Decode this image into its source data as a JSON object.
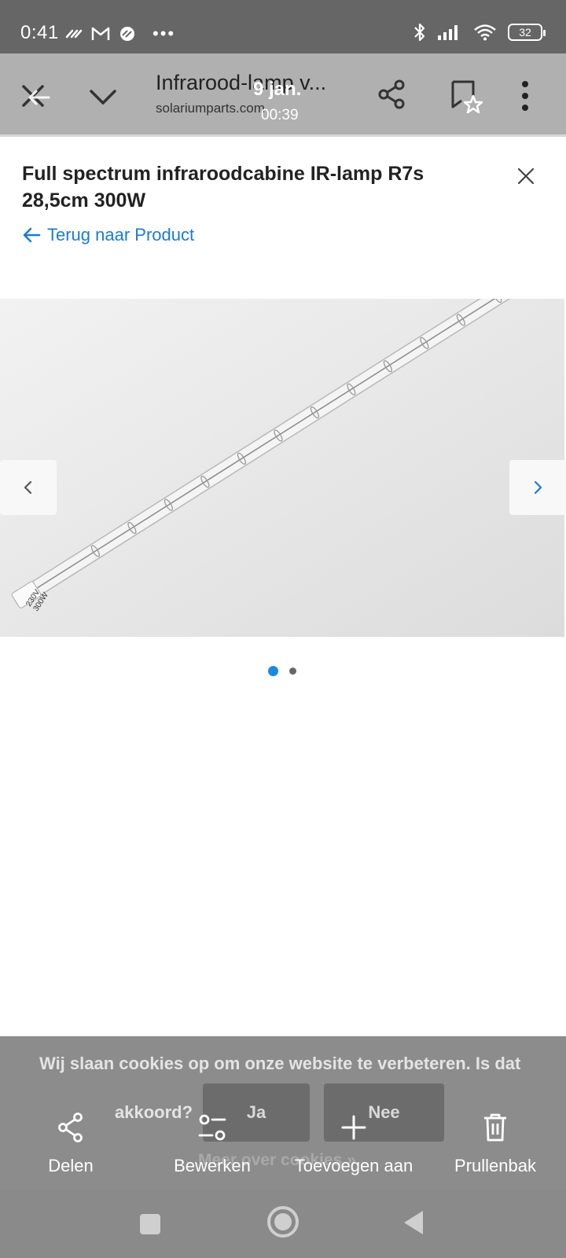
{
  "status_bar": {
    "time": "0:41",
    "battery": "32",
    "icons": [
      "link-notification-icon",
      "gmail-icon",
      "link-notification-icon",
      "more-dots-icon",
      "bluetooth-icon",
      "signal-icon",
      "wifi-icon",
      "battery-icon"
    ]
  },
  "toolbar": {
    "title": "Infrarood-lamp v...",
    "domain": "solariumparts.com",
    "overlay_date": "9 jan.",
    "overlay_time": "00:39"
  },
  "page": {
    "product_title": "Full spectrum infraroodcabine IR-lamp R7s 28,5cm 300W",
    "back_link": "Terug naar Product",
    "gallery": {
      "lamp_label_1": "230V",
      "lamp_label_2": "300W",
      "active_index": 0,
      "count": 2
    }
  },
  "cookie_banner": {
    "text": "Wij slaan cookies op om onze website te verbeteren. Is dat",
    "text2": "akkoord?",
    "yes": "Ja",
    "no": "Nee",
    "more": "Meer over cookies »"
  },
  "actions": [
    {
      "label": "Delen",
      "icon": "share-icon"
    },
    {
      "label": "Bewerken",
      "icon": "edit-sliders-icon"
    },
    {
      "label": "Toevoegen aan",
      "icon": "plus-icon"
    },
    {
      "label": "Prullenbak",
      "icon": "trash-icon"
    }
  ],
  "colors": {
    "link": "#1a7bd4",
    "dot_active": "#1a8ae0"
  }
}
